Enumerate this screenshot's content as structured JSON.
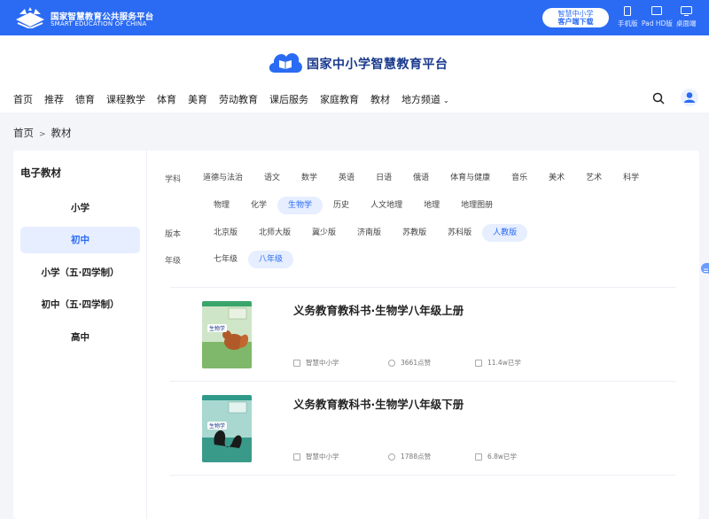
{
  "topbar": {
    "org_cn": "国家智慧教育公共服务平台",
    "org_en": "SMART EDUCATION OF CHINA",
    "download_line1": "智慧中小学",
    "download_line2": "客户端下载",
    "devices": [
      {
        "label": "手机版",
        "icon": "phone-icon"
      },
      {
        "label": "Pad HD版",
        "icon": "tablet-icon"
      },
      {
        "label": "桌面端",
        "icon": "desktop-icon"
      }
    ]
  },
  "header": {
    "brand": "国家中小学智慧教育平台",
    "nav": [
      "首页",
      "推荐",
      "德育",
      "课程教学",
      "体育",
      "美育",
      "劳动教育",
      "课后服务",
      "家庭教育",
      "教材",
      "地方频道"
    ]
  },
  "breadcrumb": {
    "home": "首页",
    "sep": ">",
    "current": "教材"
  },
  "sidebar": {
    "title": "电子教材",
    "items": [
      {
        "label": "小学",
        "active": false
      },
      {
        "label": "初中",
        "active": true
      },
      {
        "label": "小学（五·四学制）",
        "active": false
      },
      {
        "label": "初中（五·四学制）",
        "active": false
      },
      {
        "label": "高中",
        "active": false
      }
    ]
  },
  "filters": {
    "subject_label": "学科",
    "subjects_row1": [
      "道德与法治",
      "语文",
      "数学",
      "英语",
      "日语",
      "俄语",
      "体育与健康",
      "音乐",
      "美术",
      "艺术",
      "科学"
    ],
    "subjects_row2": [
      "物理",
      "化学",
      "生物学",
      "历史",
      "人文地理",
      "地理",
      "地理图册"
    ],
    "subject_active": "生物学",
    "edition_label": "版本",
    "editions": [
      "北京版",
      "北师大版",
      "冀少版",
      "济南版",
      "苏教版",
      "苏科版",
      "人教版"
    ],
    "edition_active": "人教版",
    "grade_label": "年级",
    "grades": [
      "七年级",
      "八年级"
    ],
    "grade_active": "八年级"
  },
  "books": [
    {
      "title": "义务教育教科书·生物学八年级上册",
      "source": "智慧中小学",
      "likes": "3661点赞",
      "learners": "11.4w已学",
      "cover_text": "生物学",
      "cover_color": "#7fb86a"
    },
    {
      "title": "义务教育教科书·生物学八年级下册",
      "source": "智慧中小学",
      "likes": "1788点赞",
      "learners": "6.8w已学",
      "cover_text": "生物学",
      "cover_color": "#3a9a8a"
    }
  ],
  "colors": {
    "accent": "#2b6bf3",
    "active_bg": "#e6eeff",
    "page_bg": "#f3f5f9"
  }
}
